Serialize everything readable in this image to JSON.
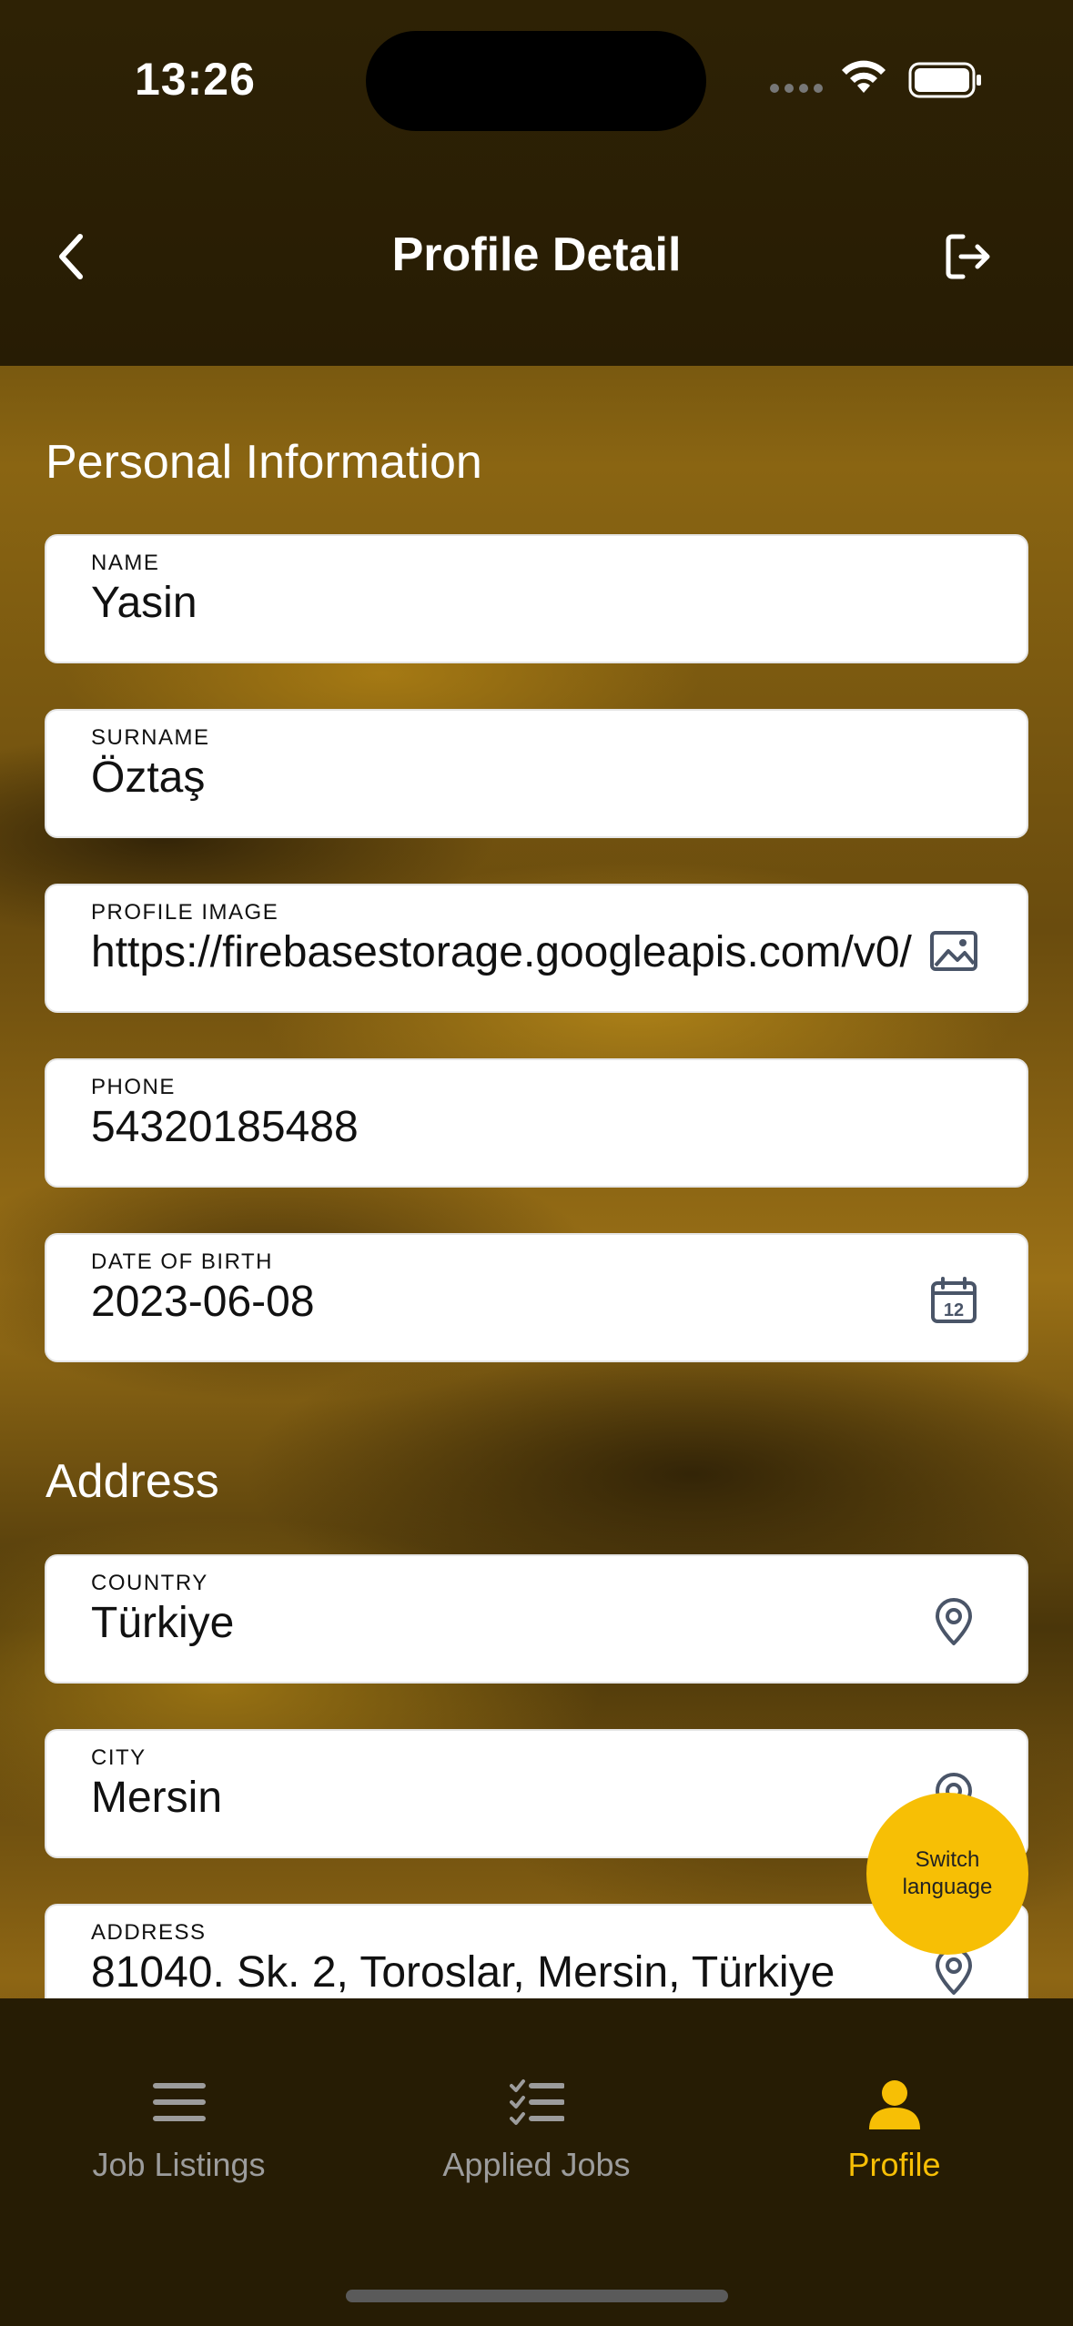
{
  "status_bar": {
    "time": "13:26"
  },
  "header": {
    "title": "Profile Detail"
  },
  "sections": {
    "personal": "Personal Information",
    "address": "Address"
  },
  "fields": {
    "name": {
      "label": "NAME",
      "value": "Yasin"
    },
    "surname": {
      "label": "SURNAME",
      "value": "Öztaş"
    },
    "profile_image": {
      "label": "PROFILE IMAGE",
      "value": "https://firebasestorage.googleapis.com/v0/"
    },
    "phone": {
      "label": "PHONE",
      "value": "54320185488"
    },
    "dob": {
      "label": "DATE OF BIRTH",
      "value": "2023-06-08"
    },
    "country": {
      "label": "COUNTRY",
      "value": "Türkiye"
    },
    "city": {
      "label": "CITY",
      "value": "Mersin"
    },
    "address": {
      "label": "ADDRESS",
      "value": "81040. Sk. 2, Toroslar, Mersin, Türkiye"
    }
  },
  "fab": {
    "label": "Switch language"
  },
  "tabs": [
    {
      "label": "Job Listings",
      "icon": "menu-icon"
    },
    {
      "label": "Applied Jobs",
      "icon": "checklist-icon"
    },
    {
      "label": "Profile",
      "icon": "person-icon"
    }
  ],
  "colors": {
    "accent": "#f7bf05",
    "inactive": "#9c9c9c",
    "icon": "#4a5568"
  }
}
